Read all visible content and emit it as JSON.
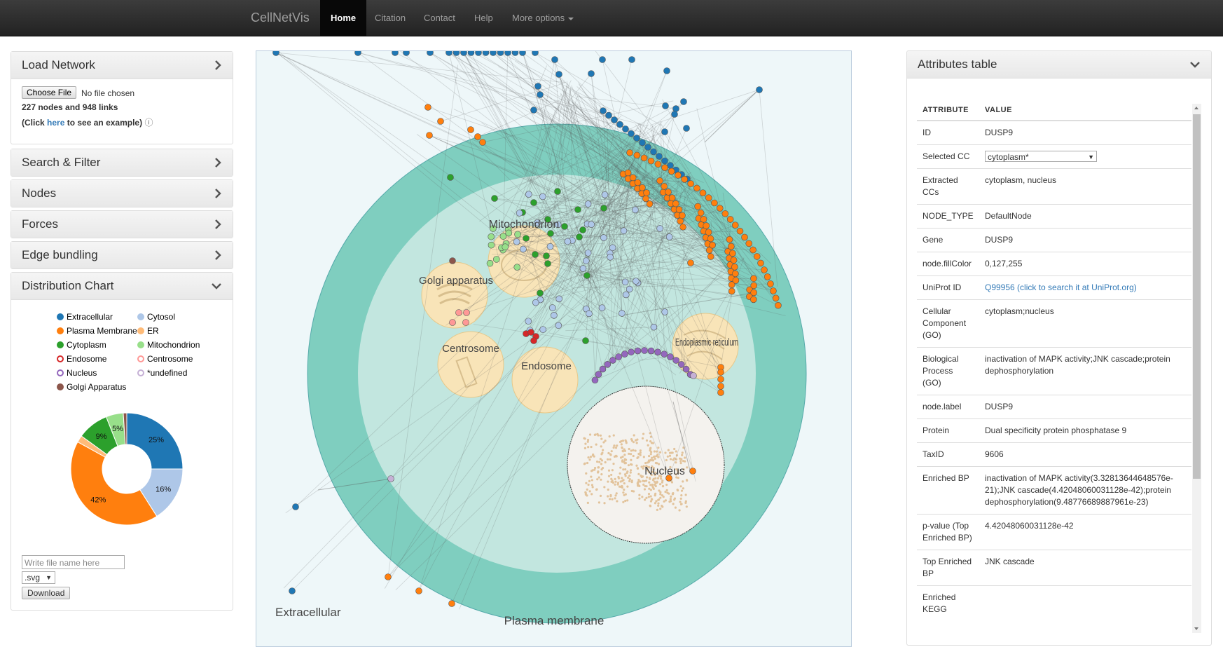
{
  "nav": {
    "brand": "CellNetVis",
    "links": [
      "Home",
      "Citation",
      "Contact",
      "Help",
      "More options"
    ]
  },
  "left": {
    "load_network": {
      "title": "Load Network",
      "choose_file": "Choose File",
      "no_file": "No file chosen",
      "stats": "227 nodes and 948 links",
      "example_pre": "(Click ",
      "example_link": "here",
      "example_post": " to see an example)"
    },
    "search_filter": "Search & Filter",
    "nodes": "Nodes",
    "forces": "Forces",
    "edge_bundling": "Edge bundling",
    "distribution_chart": "Distribution Chart",
    "legend": [
      {
        "label": "Extracellular",
        "color": "#1f77b4",
        "filled": true
      },
      {
        "label": "Cytosol",
        "color": "#aec7e8",
        "filled": true
      },
      {
        "label": "Plasma Membrane",
        "color": "#ff7f0e",
        "filled": true
      },
      {
        "label": "ER",
        "color": "#ffbb78",
        "filled": true
      },
      {
        "label": "Cytoplasm",
        "color": "#2ca02c",
        "filled": true
      },
      {
        "label": "Mitochondrion",
        "color": "#98df8a",
        "filled": true
      },
      {
        "label": "Endosome",
        "color": "#d62728",
        "filled": false
      },
      {
        "label": "Centrosome",
        "color": "#ff9896",
        "filled": false
      },
      {
        "label": "Nucleus",
        "color": "#9467bd",
        "filled": false
      },
      {
        "label": "*undefined",
        "color": "#c5b0d5",
        "filled": false
      },
      {
        "label": "Golgi Apparatus",
        "color": "#8c564b",
        "filled": true
      }
    ],
    "donut": [
      {
        "label": "25%",
        "value": 25,
        "color": "#1f77b4"
      },
      {
        "label": "16%",
        "value": 16,
        "color": "#aec7e8"
      },
      {
        "label": "42%",
        "value": 42,
        "color": "#ff7f0e"
      },
      {
        "label": "",
        "value": 2,
        "color": "#ffbb78"
      },
      {
        "label": "9%",
        "value": 9,
        "color": "#2ca02c"
      },
      {
        "label": "5%",
        "value": 5,
        "color": "#98df8a"
      },
      {
        "label": "",
        "value": 1,
        "color": "#8c564b"
      }
    ],
    "file_placeholder": "Write file name here",
    "format": ".svg",
    "download": "Download"
  },
  "network": {
    "labels": {
      "mitochondrion": "Mitochondrion",
      "golgi": "Golgi apparatus",
      "centrosome": "Centrosome",
      "endosome": "Endosome",
      "er": "Endoplasmic reticulum",
      "nucleus": "Nucleus",
      "plasma": "Plasma membrane",
      "extracellular": "Extracellular"
    },
    "colors": {
      "extracellular": "#1f77b4",
      "plasma": "#ff7f0e",
      "cytoplasm": "#2ca02c",
      "mitochondrion": "#98df8a",
      "cytosol": "#aec7e8",
      "nucleus": "#9467bd",
      "endosome": "#d62728",
      "centrosome": "#ff9896"
    }
  },
  "attributes": {
    "title": "Attributes table",
    "col_attribute": "ATTRIBUTE",
    "col_value": "VALUE",
    "rows": [
      {
        "k": "ID",
        "v": "DUSP9"
      },
      {
        "k": "Selected CC",
        "v": "cytoplasm*",
        "select": true
      },
      {
        "k": "Extracted CCs",
        "v": "cytoplasm, nucleus"
      },
      {
        "k": "NODE_TYPE",
        "v": "DefaultNode"
      },
      {
        "k": "Gene",
        "v": "DUSP9"
      },
      {
        "k": "node.fillColor",
        "v": "0,127,255"
      },
      {
        "k": "UniProt ID",
        "v": "Q99956 (click to search it at UniProt.org)",
        "link": true
      },
      {
        "k": "Cellular Component (GO)",
        "v": "cytoplasm;nucleus"
      },
      {
        "k": "Biological Process (GO)",
        "v": "inactivation of MAPK activity;JNK cascade;protein dephosphorylation"
      },
      {
        "k": "node.label",
        "v": "DUSP9"
      },
      {
        "k": "Protein",
        "v": "Dual specificity protein phosphatase 9"
      },
      {
        "k": "TaxID",
        "v": "9606"
      },
      {
        "k": "Enriched BP",
        "v": "inactivation of MAPK activity(3.32813644648576e-21);JNK cascade(4.42048060031128e-42);protein dephosphorylation(9.48776689887961e-23)"
      },
      {
        "k": "p-value (Top Enriched BP)",
        "v": "4.42048060031128e-42"
      },
      {
        "k": "Top Enriched BP",
        "v": "JNK cascade"
      },
      {
        "k": "Enriched KEGG",
        "v": ""
      }
    ]
  }
}
